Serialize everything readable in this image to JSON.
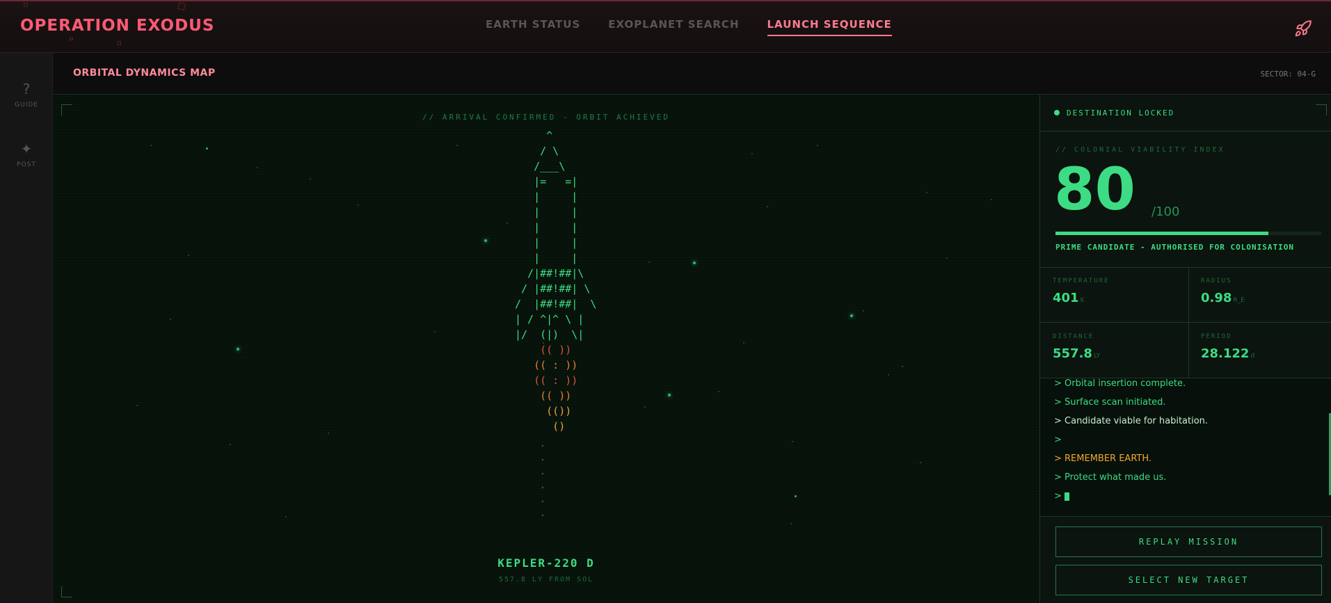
{
  "header": {
    "brand": "OPERATION EXODUS",
    "nav": [
      {
        "label": "EARTH STATUS",
        "active": false
      },
      {
        "label": "EXOPLANET SEARCH",
        "active": false
      },
      {
        "label": "LAUNCH SEQUENCE",
        "active": true
      }
    ],
    "rocket_icon": "rocket-icon"
  },
  "sidebar": {
    "items": [
      {
        "icon": "?",
        "label": "GUIDE"
      },
      {
        "icon": "✦",
        "label": "POST"
      }
    ]
  },
  "titlebar": {
    "title": "ORBITAL DYNAMICS MAP",
    "sector": "SECTOR: 04-G"
  },
  "map": {
    "arrival_text": "// ARRIVAL CONFIRMED - ORBIT ACHIEVED",
    "rocket_ascii": "     ^\n    / \\\n   /___\\\n   |=   =|\n   |     |\n   |     |\n   |     |\n   |     |\n   |     |\n  /|##!##|\\\n / |##!##| \\\n/  |##!##|  \\\n| / ^|^ \\ |\n|/  (|)  \\|",
    "flames": [
      "    (( ))",
      "   (( : ))",
      "   (( : ))",
      "    (( ))",
      "     (())",
      "      ()"
    ],
    "planet_name": "KEPLER-220 D",
    "planet_distance": "557.8 LY FROM SOL"
  },
  "panel": {
    "status": "DESTINATION LOCKED",
    "cvi_label": "// COLONIAL VIABILITY INDEX",
    "score": "80",
    "score_max": "/100",
    "score_fraction": 0.8,
    "verdict": "PRIME CANDIDATE - AUTHORISED FOR COLONISATION",
    "stats": [
      {
        "label": "TEMPERATURE",
        "value": "401",
        "unit": "K"
      },
      {
        "label": "RADIUS",
        "value": "0.98",
        "unit": "R_E"
      },
      {
        "label": "DISTANCE",
        "value": "557.8",
        "unit": "LY"
      },
      {
        "label": "PERIOD",
        "value": "28.122",
        "unit": "d"
      }
    ],
    "console": [
      {
        "text": "> Orbital insertion complete.",
        "style": "green"
      },
      {
        "text": "> Surface scan initiated.",
        "style": "green"
      },
      {
        "text": "> Candidate viable for habitation.",
        "style": "white"
      },
      {
        "text": ">",
        "style": "green"
      },
      {
        "text": "> REMEMBER EARTH.",
        "style": "orange"
      },
      {
        "text": "> Protect what made us.",
        "style": "green"
      },
      {
        "text": ">",
        "style": "green"
      }
    ],
    "buttons": {
      "replay": "REPLAY MISSION",
      "select": "SELECT NEW TARGET"
    }
  },
  "colors": {
    "accent_green": "#3ddc84",
    "brand_pink": "#ff5a73",
    "warning_orange": "#f0a830"
  }
}
